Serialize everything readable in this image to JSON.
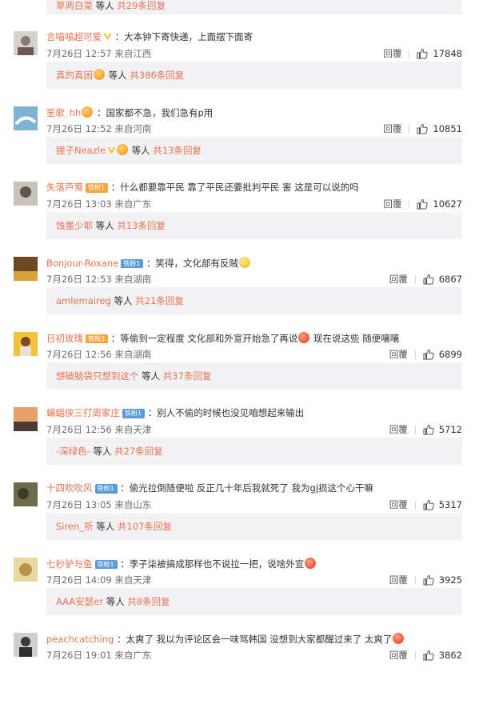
{
  "top_reply": {
    "author": "草两白菜",
    "suffix": "等人",
    "count_label": "共29条回复"
  },
  "actions": {
    "reply_label": "回覆"
  },
  "comments": [
    {
      "username": "言喵喵超可爱",
      "text": "：大本钟下寄快递，上面摆下面寄",
      "time": "7月26日 12:57",
      "location": "来自江西",
      "reply_label": "回覆",
      "likes": "17848",
      "sub": {
        "author": "真的真困",
        "suffix": "等人",
        "count_label": "共386条回复"
      }
    },
    {
      "username": "笙歌_hh",
      "text": "：国家都不急，我们急有p用",
      "time": "7月26日 12:52",
      "location": "来自河南",
      "reply_label": "回覆",
      "likes": "10851",
      "sub": {
        "author": "狸子Neazle",
        "suffix": "等人",
        "count_label": "共13条回复"
      }
    },
    {
      "username": "失落芦莺",
      "badge": "铁粉1",
      "text": "：什么都要靠平民 靠了平民还要批判平民 害 这是可以说的吗",
      "time": "7月26日 13:03",
      "location": "来自广东",
      "reply_label": "回覆",
      "likes": "10627",
      "sub": {
        "author": "蚀墨少耶",
        "suffix": "等人",
        "count_label": "共13条回复"
      }
    },
    {
      "username": "Bonjour-Roxane",
      "badge": "铁粉1",
      "text": "：笑得，文化部有反贼",
      "time": "7月26日 12:53",
      "location": "来自湖南",
      "reply_label": "回覆",
      "likes": "6867",
      "sub": {
        "author": "amlemaireg",
        "suffix": "等人",
        "count_label": "共21条回复"
      }
    },
    {
      "username": "日初玫瑰",
      "badge": "铁粉3",
      "text": "：等偷到一定程度 文化部和外宣开始急了再说",
      "text2": " 现在说这些 随便嚷嚷",
      "time": "7月26日 12:56",
      "location": "来自湖南",
      "reply_label": "回覆",
      "likes": "6899",
      "sub": {
        "author": "想破脑袋只想到这个",
        "suffix": "等人",
        "count_label": "共37条回复"
      }
    },
    {
      "username": "蝙蝠侠三打周家庄",
      "badge": "铁粉1",
      "text": "：别人不偷的时候也没见咱想起来输出",
      "time": "7月26日 12:56",
      "location": "来自天津",
      "reply_label": "回覆",
      "likes": "5712",
      "sub": {
        "author": "-深绿色-",
        "suffix": "等人",
        "count_label": "共27条回复"
      }
    },
    {
      "username": "十四吹吹风",
      "badge": "铁粉1",
      "text": "：偷光拉倒随便啦 反正几十年后我就死了 我为gj损这个心干嘛",
      "time": "7月26日 13:05",
      "location": "来自山东",
      "reply_label": "回覆",
      "likes": "5317",
      "sub": {
        "author": "Siren_祈",
        "suffix": "等人",
        "count_label": "共107条回复"
      }
    },
    {
      "username": "七秒驴与鱼",
      "badge": "铁粉1",
      "text": "：李子柒被搞成那样也不说拉一把，说啥外宣",
      "time": "7月26日 14:09",
      "location": "来自天津",
      "reply_label": "回覆",
      "likes": "3925",
      "sub": {
        "author": "AAA安瑟er",
        "suffix": "等人",
        "count_label": "共8条回复"
      }
    },
    {
      "username": "peachcatching",
      "text": "：太爽了 我以为评论区会一味骂韩国 没想到大家都醒过来了 太爽了",
      "time": "7月26日 19:01",
      "location": "来自广东",
      "reply_label": "回覆",
      "likes": "3862"
    }
  ],
  "colors": {
    "accent": "#eb7350",
    "sub_bg": "#f2f2f5",
    "badge_orange": "#f9a43f",
    "badge_blue": "#5a9bdc"
  }
}
